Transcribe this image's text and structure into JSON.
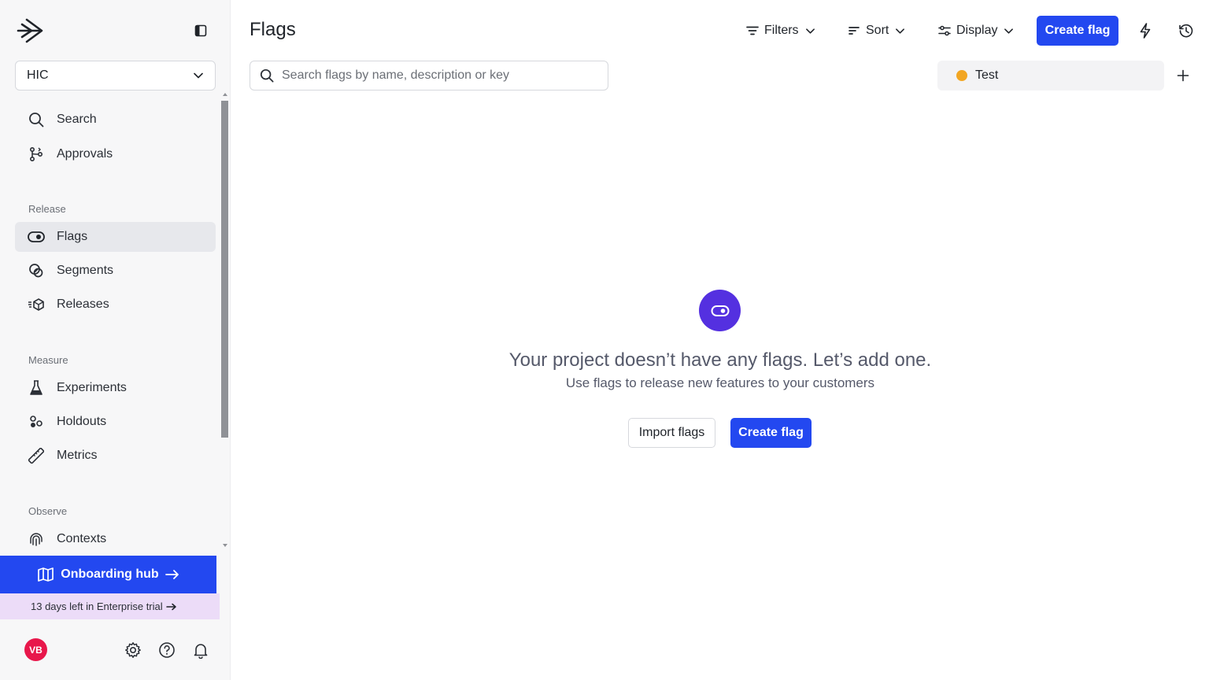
{
  "sidebar": {
    "project": "HIC",
    "nav_top": [
      {
        "label": "Search",
        "icon": "search-icon"
      },
      {
        "label": "Approvals",
        "icon": "git-merge-icon"
      }
    ],
    "sections": [
      {
        "label": "Release",
        "items": [
          {
            "label": "Flags",
            "icon": "toggle-icon",
            "active": true
          },
          {
            "label": "Segments",
            "icon": "segments-icon"
          },
          {
            "label": "Releases",
            "icon": "releases-icon"
          }
        ]
      },
      {
        "label": "Measure",
        "items": [
          {
            "label": "Experiments",
            "icon": "flask-icon"
          },
          {
            "label": "Holdouts",
            "icon": "holdouts-icon"
          },
          {
            "label": "Metrics",
            "icon": "ruler-icon"
          }
        ]
      },
      {
        "label": "Observe",
        "items": [
          {
            "label": "Contexts",
            "icon": "fingerprint-icon"
          }
        ]
      }
    ],
    "onboarding_label": "Onboarding hub",
    "trial_text": "13 days left in Enterprise trial",
    "avatar_initials": "VB"
  },
  "header": {
    "title": "Flags",
    "filters_label": "Filters",
    "sort_label": "Sort",
    "display_label": "Display",
    "create_label": "Create flag"
  },
  "search": {
    "placeholder": "Search flags by name, description or key",
    "value": ""
  },
  "environment": {
    "name": "Test",
    "color": "#f2a623"
  },
  "empty_state": {
    "title": "Your project doesn’t have any flags. Let’s add one.",
    "subtitle": "Use flags to release new features to your customers",
    "import_label": "Import flags",
    "create_label": "Create flag"
  },
  "colors": {
    "accent": "#2348f0",
    "empty_icon_bg": "#5430e0",
    "trial_bg": "#ecdcf8",
    "avatar_bg": "#e8174b"
  }
}
